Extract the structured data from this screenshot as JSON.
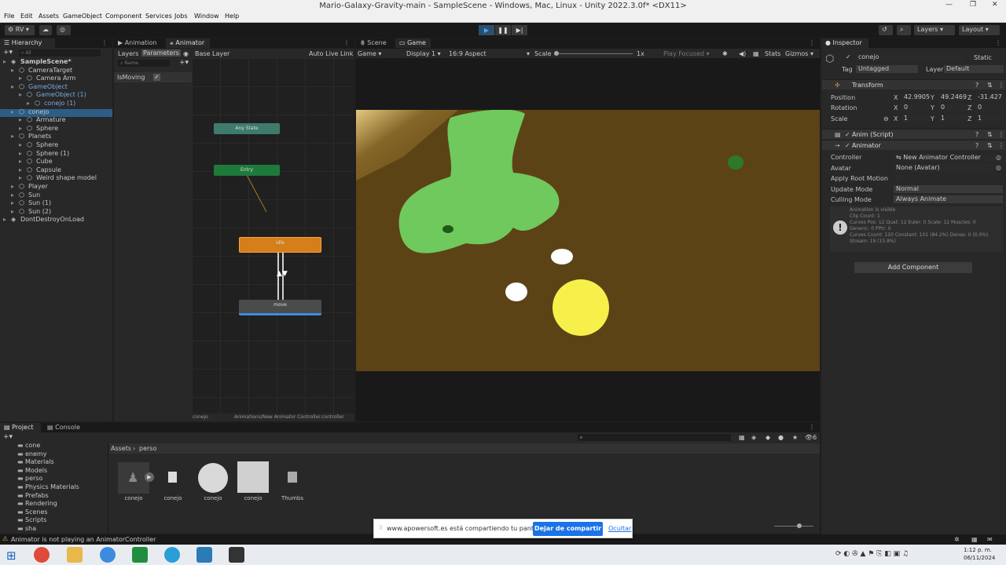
{
  "window": {
    "title": "Mario-Galaxy-Gravity-main - SampleScene - Windows, Mac, Linux - Unity 2022.3.0f* <DX11>"
  },
  "menu": [
    "File",
    "Edit",
    "Assets",
    "GameObject",
    "Component",
    "Services",
    "Jobs",
    "Window",
    "Help"
  ],
  "toolbar": {
    "account": "RV",
    "layers": "Layers",
    "layout": "Layout"
  },
  "hierarchy": {
    "tab": "Hierarchy",
    "search_placeholder": "All",
    "items": [
      {
        "label": "SampleScene*"
      },
      {
        "label": "CameraTarget"
      },
      {
        "label": "Camera Arm"
      },
      {
        "label": "GameObject"
      },
      {
        "label": "GameObject (1)"
      },
      {
        "label": "conejo (1)"
      },
      {
        "label": "conejo"
      },
      {
        "label": "Armature"
      },
      {
        "label": "Sphere"
      },
      {
        "label": "Planets"
      },
      {
        "label": "Sphere"
      },
      {
        "label": "Sphere (1)"
      },
      {
        "label": "Cube"
      },
      {
        "label": "Capsule"
      },
      {
        "label": "Weird shape model"
      },
      {
        "label": "Player"
      },
      {
        "label": "Sun"
      },
      {
        "label": "Sun (1)"
      },
      {
        "label": "Sun (2)"
      },
      {
        "label": "DontDestroyOnLoad"
      }
    ]
  },
  "animator": {
    "tabs": [
      "Animation",
      "Animator"
    ],
    "sub_tabs": [
      "Layers",
      "Parameters"
    ],
    "layer": "Base Layer",
    "auto_live_link": "Auto Live Link",
    "search_placeholder": "Name",
    "param": "IsMoving",
    "nodes": {
      "any_state": "Any State",
      "entry": "Entry",
      "idle": "idle",
      "move": "move"
    },
    "footer_left": "conejo",
    "footer_right": "Animations/New Animator Controller.controller"
  },
  "scene": {
    "tabs": [
      "Scene",
      "Game"
    ],
    "game": "Game",
    "display": "Display 1",
    "aspect": "16:9 Aspect",
    "scale_label": "Scale",
    "scale_value": "1x",
    "play_focused": "Play Focused",
    "stats": "Stats",
    "gizmos": "Gizmos"
  },
  "inspector": {
    "tab": "Inspector",
    "object_name": "conejo",
    "static": "Static",
    "tag_label": "Tag",
    "tag": "Untagged",
    "layer_label": "Layer",
    "layer": "Default",
    "transform": {
      "title": "Transform",
      "position_label": "Position",
      "rotation_label": "Rotation",
      "scale_label": "Scale",
      "pos": [
        "42.9905",
        "49.2469",
        "-31.427"
      ],
      "rot": [
        "0",
        "0",
        "0"
      ],
      "scl": [
        "1",
        "1",
        "1"
      ],
      "axes": [
        "X",
        "Y",
        "Z"
      ]
    },
    "anim_script": "Anim (Script)",
    "animator": {
      "title": "Animator",
      "controller_label": "Controller",
      "controller": "New Animator Controller",
      "avatar_label": "Avatar",
      "avatar": "None (Avatar)",
      "root_motion_label": "Apply Root Motion",
      "update_mode_label": "Update Mode",
      "update_mode": "Normal",
      "culling_label": "Culling Mode",
      "culling": "Always Animate",
      "info": [
        "Animation is visible",
        "Clip Count: 1",
        "Curves Pos: 12 Quat: 12 Euler: 0 Scale: 12 Muscles: 0",
        "Generic: 0 PPtr: 0",
        "Curves Count: 120 Constant: 101 (84.2%) Dense: 0 (0.0%)",
        "Stream: 19 (15.8%)"
      ]
    },
    "add_component": "Add Component"
  },
  "project": {
    "tabs": [
      "Project",
      "Console"
    ],
    "breadcrumb": [
      "Assets",
      "perso"
    ],
    "folders": [
      "cone",
      "enemy",
      "Materials",
      "Models",
      "perso",
      "Physics Materials",
      "Prefabs",
      "Rendering",
      "Scenes",
      "Scripts",
      "sha"
    ],
    "assets": [
      "conejo",
      "conejo",
      "conejo",
      "conejo",
      "Thumbs"
    ],
    "count": "6"
  },
  "status": {
    "warning": "Animator is not playing an AnimatorController"
  },
  "share": {
    "text": "www.apowersoft.es está compartiendo tu pantalla.",
    "stop": "Dejar de compartir",
    "hide": "Ocultar"
  },
  "clock": {
    "time": "1:12 p. m.",
    "date": "06/11/2024"
  },
  "colors": {
    "accent": "#2c5d87",
    "game_bg": "#5c4316",
    "planet_green": "#6fc95d",
    "sun": "#f7f04a"
  }
}
